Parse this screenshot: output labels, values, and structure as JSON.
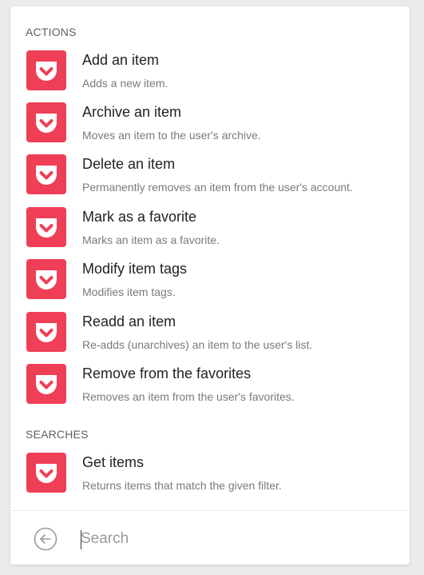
{
  "colors": {
    "icon_bg": "#ef3f56",
    "icon_fg": "#ffffff"
  },
  "sections": {
    "actions": {
      "header": "ACTIONS",
      "items": [
        {
          "title": "Add an item",
          "description": "Adds a new item.",
          "icon": "pocket-icon"
        },
        {
          "title": "Archive an item",
          "description": "Moves an item to the user's archive.",
          "icon": "pocket-icon"
        },
        {
          "title": "Delete an item",
          "description": "Permanently removes an item from the user's account.",
          "icon": "pocket-icon"
        },
        {
          "title": "Mark as a favorite",
          "description": "Marks an item as a favorite.",
          "icon": "pocket-icon"
        },
        {
          "title": "Modify item tags",
          "description": "Modifies item tags.",
          "icon": "pocket-icon"
        },
        {
          "title": "Readd an item",
          "description": "Re-adds (unarchives) an item to the user's list.",
          "icon": "pocket-icon"
        },
        {
          "title": "Remove from the favorites",
          "description": "Removes an item from the user's favorites.",
          "icon": "pocket-icon"
        }
      ]
    },
    "searches": {
      "header": "SEARCHES",
      "items": [
        {
          "title": "Get items",
          "description": "Returns items that match the given filter.",
          "icon": "pocket-icon"
        }
      ]
    }
  },
  "search": {
    "placeholder": "Search",
    "value": "",
    "back_icon": "back-arrow-icon"
  }
}
